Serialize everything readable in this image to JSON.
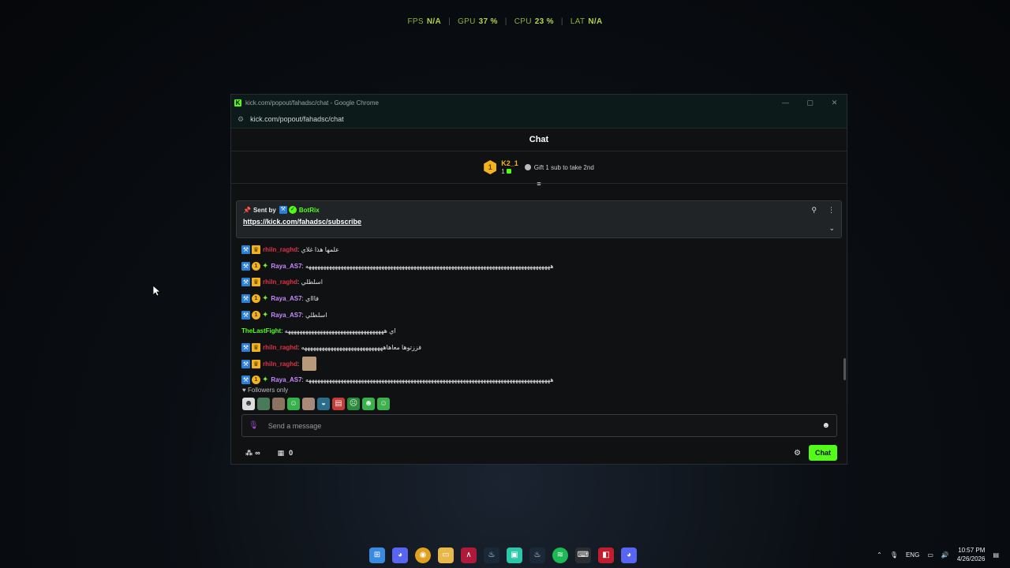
{
  "overlay": {
    "fps_label": "FPS",
    "fps_value": "N/A",
    "gpu_label": "GPU",
    "gpu_value": "37 %",
    "cpu_label": "CPU",
    "cpu_value": "23 %",
    "lat_label": "LAT",
    "lat_value": "N/A"
  },
  "browser": {
    "title": "kick.com/popout/fahadsc/chat - Google Chrome",
    "url": "kick.com/popout/fahadsc/chat",
    "minimize": "—",
    "maximize": "▢",
    "close": "✕"
  },
  "chat": {
    "header": "Chat",
    "leader": {
      "rank": "1",
      "name": "K2_1",
      "count": "1"
    },
    "gift_tip": "Gift 1 sub to take 2nd",
    "pinned": {
      "sent_by": "Sent by",
      "author": "BotRix",
      "link": "https://kick.com/fahadsc/subscribe"
    },
    "messages": [
      {
        "user": "rhiln_raghd",
        "style": "red",
        "badges": [
          "mod",
          "crown"
        ],
        "text": "علمها هذا غلاي"
      },
      {
        "user": "Raya_AS7",
        "style": "purple",
        "badges": [
          "mod",
          "gold",
          "star"
        ],
        "text": "ههههههههههههههههههههههههههههههههههههههههههههههههههههههههههههههههههههههههههههههههههههه"
      },
      {
        "user": "rhiln_raghd",
        "style": "red",
        "badges": [
          "mod",
          "crown"
        ],
        "text": "اسلطلي"
      },
      {
        "user": "Raya_AS7",
        "style": "purple",
        "badges": [
          "mod",
          "gold",
          "star"
        ],
        "text": "فاااي"
      },
      {
        "user": "Raya_AS7",
        "style": "purple",
        "badges": [
          "mod",
          "gold",
          "star"
        ],
        "text": "اسلطلي"
      },
      {
        "user": "TheLastFight",
        "style": "green",
        "badges": [],
        "text": "اي ههههههههههههههههههههههههههههههههههه"
      },
      {
        "user": "rhiln_raghd",
        "style": "red",
        "badges": [
          "mod",
          "crown"
        ],
        "text": "فززتوها معاهاههههههههههههههههههههههههههههه"
      },
      {
        "user": "rhiln_raghd",
        "style": "red",
        "badges": [
          "mod",
          "crown"
        ],
        "text": ""
      },
      {
        "user": "Raya_AS7",
        "style": "purple",
        "badges": [
          "mod",
          "gold",
          "star"
        ],
        "text": "ههههههههههههههههههههههههههههههههههههههههههههههههههههههههههههههههههههههههههههههههههههه"
      }
    ],
    "followers_only": "Followers only",
    "input_placeholder": "Send a message",
    "points_symbol": "∞",
    "store_count": "0",
    "chat_button": "Chat"
  },
  "taskbar": {
    "lang": "ENG",
    "time": "10:57 PM",
    "date": "4/26/2026"
  }
}
